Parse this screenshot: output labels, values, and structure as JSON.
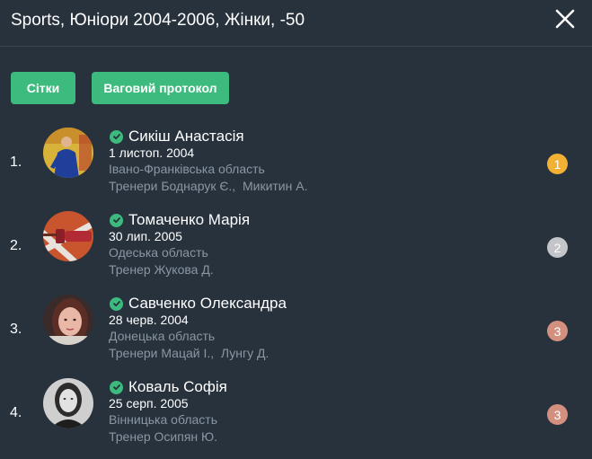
{
  "header": {
    "title": "Sports, Юніори 2004-2006, Жінки, -50"
  },
  "toolbar": {
    "grids_label": "Сітки",
    "weight_protocol_label": "Ваговий протокол"
  },
  "athletes": [
    {
      "rank": "1.",
      "name": "Сикіш Анастасія",
      "dob": "1 листоп. 2004",
      "region": "Івано-Франківська область",
      "coach": "Тренери Боднарук Є.,  Микитин А.",
      "medal": "1",
      "medal_color": "#f2b134"
    },
    {
      "rank": "2.",
      "name": "Томаченко Марія",
      "dob": "30 лип. 2005",
      "region": "Одеська область",
      "coach": "Тренер Жукова Д.",
      "medal": "2",
      "medal_color": "#c3c5c8"
    },
    {
      "rank": "3.",
      "name": "Савченко Олександра",
      "dob": "28 черв. 2004",
      "region": "Донецька область",
      "coach": "Тренери Мацай І.,  Лунгу Д.",
      "medal": "3",
      "medal_color": "#d4907e"
    },
    {
      "rank": "4.",
      "name": "Коваль Софія",
      "dob": "25 серп. 2005",
      "region": "Вінницька область",
      "coach": "Тренер Осипян Ю.",
      "medal": "3",
      "medal_color": "#d4907e"
    }
  ],
  "colors": {
    "background": "#27323d",
    "accent": "#3dba7e",
    "muted_text": "#8b96a2"
  }
}
